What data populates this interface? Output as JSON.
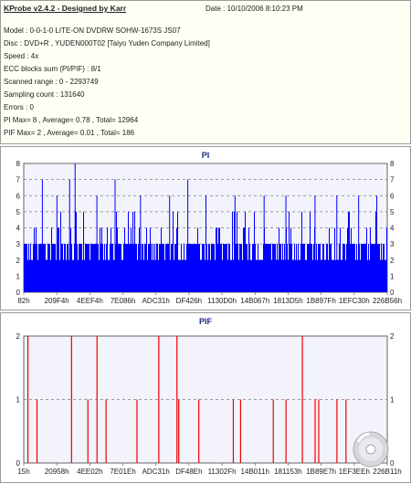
{
  "header": {
    "title": "KProbe v2.4.2 - Designed by Karr",
    "date": "Date : 10/10/2006 8:10:23 PM",
    "lines": [
      "Model : 0-0-1-0 LITE-ON DVDRW SOHW-1673S JS07",
      "Disc : DVD+R , YUDEN000T02 [Taiyo Yuden Company Limited]",
      "Speed : 4x",
      "ECC blocks sum (PI/PIF) : 8/1",
      "Scanned range : 0 - 2293749",
      "Sampling count : 131640",
      "Errors : 0",
      "PI Max= 8 , Average= 0.78 , Total= 12964",
      "PIF Max= 2 , Average= 0.01 , Total= 186"
    ]
  },
  "colors": {
    "pi": "#0000ff",
    "pif": "#ee0000",
    "grid": "#7f7f7f",
    "panel_bg": "#ffffff",
    "plot_bg": "#f3f3fb"
  },
  "chart_data": [
    {
      "type": "bar",
      "title": "PI",
      "ylim": [
        0,
        8
      ],
      "yticks": [
        "0",
        "1",
        "2",
        "3",
        "4",
        "5",
        "6",
        "7",
        "8"
      ],
      "xticks": [
        "82h",
        "209F4h",
        "4EEF4h",
        "7E086h",
        "ADC31h",
        "DF426h",
        "1130D0h",
        "14B067h",
        "1813D5h",
        "1B897Fh",
        "1EFC30h",
        "226B56h"
      ],
      "max": 8,
      "average": 0.78,
      "typical_range": [
        2,
        3
      ],
      "spikes": [
        {
          "x": 0.05,
          "y": 7
        },
        {
          "x": 0.09,
          "y": 6
        },
        {
          "x": 0.125,
          "y": 7
        },
        {
          "x": 0.14,
          "y": 8
        },
        {
          "x": 0.2,
          "y": 6
        },
        {
          "x": 0.25,
          "y": 7
        },
        {
          "x": 0.32,
          "y": 6
        },
        {
          "x": 0.4,
          "y": 6
        },
        {
          "x": 0.45,
          "y": 7
        },
        {
          "x": 0.5,
          "y": 6
        },
        {
          "x": 0.58,
          "y": 6
        },
        {
          "x": 0.66,
          "y": 6
        },
        {
          "x": 0.72,
          "y": 6
        },
        {
          "x": 0.8,
          "y": 6
        },
        {
          "x": 0.86,
          "y": 6
        },
        {
          "x": 0.92,
          "y": 6
        },
        {
          "x": 0.97,
          "y": 6
        }
      ],
      "grid": true
    },
    {
      "type": "bar",
      "title": "PIF",
      "ylim": [
        0,
        2
      ],
      "yticks": [
        "0",
        "1",
        "2"
      ],
      "xticks": [
        "15h",
        "20958h",
        "4EE02h",
        "7E01Eh",
        "ADC31h",
        "DF48Eh",
        "11302Fh",
        "14B011h",
        "181153h",
        "1B89E7h",
        "1EF3EEh",
        "226B11h"
      ],
      "max": 2,
      "average": 0.01,
      "bars": [
        {
          "x": 0.01,
          "y": 2
        },
        {
          "x": 0.035,
          "y": 1
        },
        {
          "x": 0.13,
          "y": 2
        },
        {
          "x": 0.175,
          "y": 1
        },
        {
          "x": 0.2,
          "y": 2
        },
        {
          "x": 0.225,
          "y": 1
        },
        {
          "x": 0.31,
          "y": 1
        },
        {
          "x": 0.37,
          "y": 2
        },
        {
          "x": 0.42,
          "y": 2
        },
        {
          "x": 0.425,
          "y": 1
        },
        {
          "x": 0.48,
          "y": 1
        },
        {
          "x": 0.575,
          "y": 1
        },
        {
          "x": 0.595,
          "y": 1
        },
        {
          "x": 0.685,
          "y": 1
        },
        {
          "x": 0.72,
          "y": 1
        },
        {
          "x": 0.765,
          "y": 2
        },
        {
          "x": 0.8,
          "y": 1
        },
        {
          "x": 0.81,
          "y": 1
        },
        {
          "x": 0.86,
          "y": 1
        },
        {
          "x": 0.885,
          "y": 1
        }
      ],
      "grid": true
    }
  ]
}
